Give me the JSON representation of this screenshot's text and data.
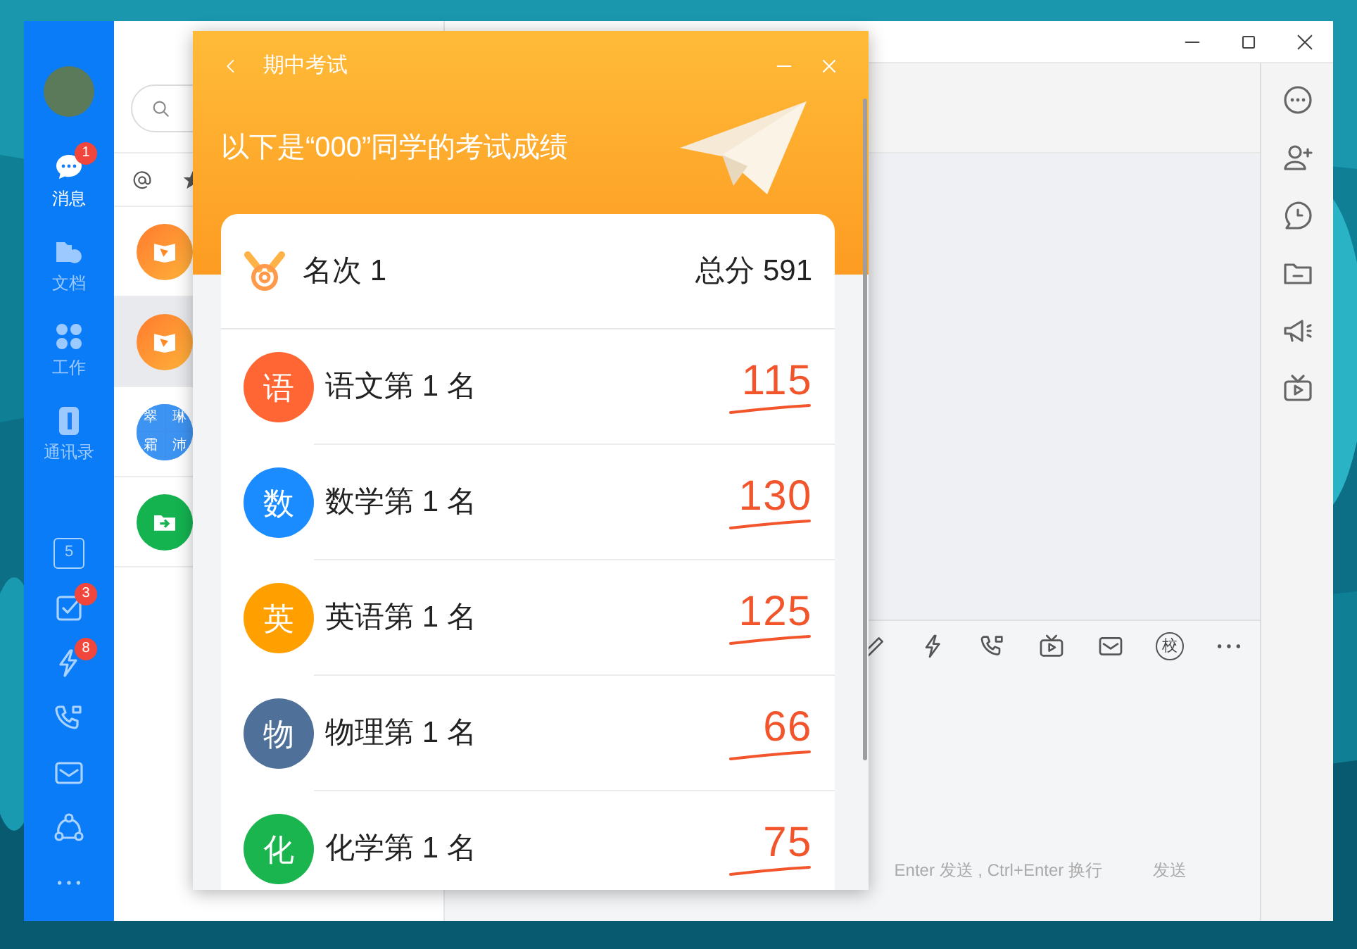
{
  "sidebar": {
    "items": [
      {
        "label": "消息",
        "selected": true,
        "badge": "1",
        "kind": "chat"
      },
      {
        "label": "文档",
        "selected": false,
        "kind": "docs"
      },
      {
        "label": "工作",
        "selected": false,
        "kind": "apps"
      },
      {
        "label": "通讯录",
        "selected": false,
        "kind": "contacts"
      }
    ],
    "tools": [
      {
        "kind": "calendar",
        "text": "5"
      },
      {
        "kind": "task",
        "badge": "3"
      },
      {
        "kind": "flash",
        "badge": "8"
      },
      {
        "kind": "call"
      },
      {
        "kind": "mail"
      },
      {
        "kind": "org"
      },
      {
        "kind": "more"
      }
    ]
  },
  "chat_list": {
    "items": [
      {
        "kind": "book",
        "selected": false
      },
      {
        "kind": "book",
        "selected": true
      },
      {
        "kind": "grid",
        "chars": [
          "翠",
          "琳",
          "霜",
          "沛"
        ],
        "selected": false
      },
      {
        "kind": "folder",
        "selected": false
      }
    ]
  },
  "composer": {
    "tools": [
      {
        "kind": "cut"
      },
      {
        "kind": "flash"
      },
      {
        "kind": "call"
      },
      {
        "kind": "tv"
      },
      {
        "kind": "mail"
      },
      {
        "kind": "school"
      },
      {
        "kind": "more"
      }
    ],
    "school_label": "校",
    "hint": "Enter 发送 , Ctrl+Enter 换行",
    "send": "发送"
  },
  "dialog": {
    "title": "期中考试",
    "headline": "以下是“000”同学的考试成绩",
    "rank": "名次 1",
    "total": "总分 591",
    "subjects": [
      {
        "icon": "语",
        "name": "语文第 1 名",
        "score": "115",
        "color": "#ff6633"
      },
      {
        "icon": "数",
        "name": "数学第 1 名",
        "score": "130",
        "color": "#1a8cff"
      },
      {
        "icon": "英",
        "name": "英语第 1 名",
        "score": "125",
        "color": "#ffa000"
      },
      {
        "icon": "物",
        "name": "物理第 1 名",
        "score": "66",
        "color": "#4f7099"
      },
      {
        "icon": "化",
        "name": "化学第 1 名",
        "score": "75",
        "color": "#1ab54e"
      }
    ]
  }
}
